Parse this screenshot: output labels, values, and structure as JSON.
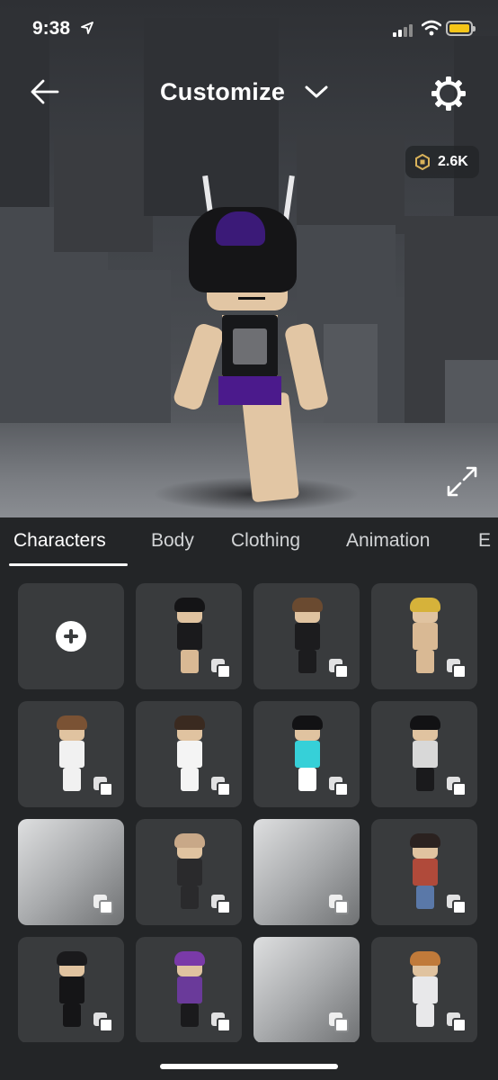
{
  "status_bar": {
    "time": "9:38",
    "icons": [
      "location-arrow-icon",
      "cellular-signal-icon",
      "wifi-icon",
      "battery-icon"
    ],
    "battery_color": "#f5c518"
  },
  "header": {
    "back_icon": "arrow-left-icon",
    "title": "Customize",
    "title_icon": "chevron-down-icon",
    "settings_icon": "gear-icon"
  },
  "currency": {
    "icon": "robux-icon",
    "amount": "2.6K"
  },
  "viewer": {
    "expand_icon": "expand-arrows-icon"
  },
  "tabs": [
    {
      "label": "Characters",
      "active": true
    },
    {
      "label": "Body",
      "active": false
    },
    {
      "label": "Clothing",
      "active": false
    },
    {
      "label": "Animation",
      "active": false
    },
    {
      "label": "E",
      "active": false
    }
  ],
  "grid": {
    "create_icon": "plus-circle-icon",
    "copy_icon": "duplicate-icon",
    "tiles": [
      {
        "kind": "create"
      },
      {
        "kind": "avatar",
        "hair": "#141416",
        "body": "#1a1a1c",
        "legs": "#d9b994"
      },
      {
        "kind": "avatar",
        "hair": "#6a4a30",
        "body": "#1c1c1e",
        "legs": "#1c1c1e"
      },
      {
        "kind": "avatar",
        "hair": "#d6b23a",
        "body": "#d9b994",
        "legs": "#d9b994"
      },
      {
        "kind": "avatar",
        "hair": "#7a5234",
        "body": "#f1f1f1",
        "legs": "#f1f1f1"
      },
      {
        "kind": "avatar",
        "hair": "#3a2a20",
        "body": "#f4f4f4",
        "legs": "#f4f4f4"
      },
      {
        "kind": "avatar",
        "hair": "#121214",
        "body": "#36d0d8",
        "legs": "#ffffff"
      },
      {
        "kind": "avatar",
        "hair": "#121214",
        "body": "#d8d8d8",
        "legs": "#1a1a1c"
      },
      {
        "kind": "placeholder"
      },
      {
        "kind": "avatar",
        "hair": "#c8a888",
        "body": "#2a2a2c",
        "legs": "#2a2a2c"
      },
      {
        "kind": "placeholder"
      },
      {
        "kind": "avatar",
        "hair": "#2b2220",
        "body": "#b04a3a",
        "legs": "#5a78a8"
      },
      {
        "kind": "avatar",
        "hair": "#1a1a1c",
        "body": "#151517",
        "legs": "#151517"
      },
      {
        "kind": "avatar",
        "hair": "#7a3aa8",
        "body": "#6a3a9a",
        "legs": "#1a1a1c"
      },
      {
        "kind": "placeholder"
      },
      {
        "kind": "avatar",
        "hair": "#c07a3a",
        "body": "#e8e8ea",
        "legs": "#e8e8ea"
      }
    ]
  }
}
